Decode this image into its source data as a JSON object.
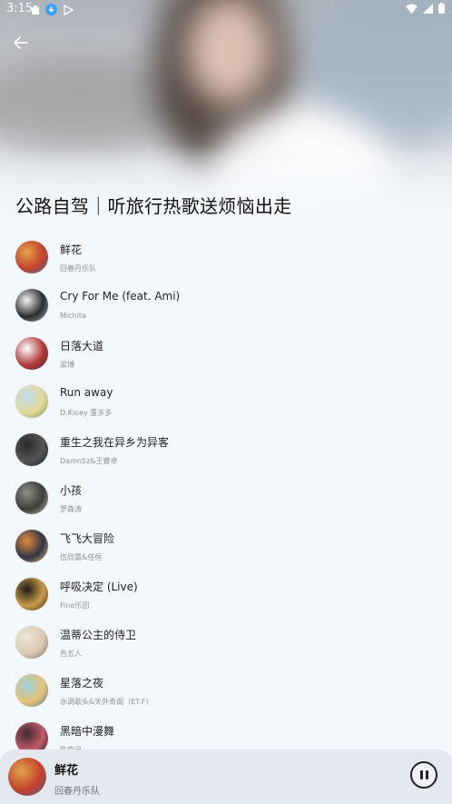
{
  "status_bar": {
    "time": "3:15"
  },
  "playlist": {
    "title": "公路自驾｜听旅行热歌送烦恼出走"
  },
  "songs": [
    {
      "title": "鲜花",
      "artist": "回春丹乐队",
      "cover_colors": [
        "#e2a44a",
        "#c3412e",
        "#4a6a8a"
      ]
    },
    {
      "title": "Cry For Me (feat. Ami)",
      "artist": "Michita",
      "cover_colors": [
        "#f2f2f2",
        "#2b2b2b",
        "#9bb5c8"
      ]
    },
    {
      "title": "日落大道",
      "artist": "梁博",
      "cover_colors": [
        "#ffffff",
        "#b23a3a",
        "#3a2a2a"
      ]
    },
    {
      "title": "Run away",
      "artist": "D.Kloey 董多多",
      "cover_colors": [
        "#bfe0ee",
        "#e6d79a",
        "#6a9a6a"
      ]
    },
    {
      "title": "重生之我在异乡为异客",
      "artist": "Damn5z&王睿卓",
      "cover_colors": [
        "#2a2a2a",
        "#555555",
        "#1a1a1a"
      ]
    },
    {
      "title": "小孩",
      "artist": "罗森涛",
      "cover_colors": [
        "#8a8f88",
        "#3d3d3a",
        "#c9c2b6"
      ]
    },
    {
      "title": "飞飞大冒险",
      "artist": "伍欣蕾&任恒",
      "cover_colors": [
        "#e58a3c",
        "#2f3548",
        "#f0c070"
      ]
    },
    {
      "title": "呼吸决定 (Live)",
      "artist": "Fine乐团",
      "cover_colors": [
        "#1d1a16",
        "#c79a4a",
        "#3a2c1a"
      ]
    },
    {
      "title": "温蒂公主的侍卫",
      "artist": "告五人",
      "cover_colors": [
        "#ece6db",
        "#d9cbb4",
        "#7b6a55"
      ]
    },
    {
      "title": "星落之夜",
      "artist": "水调歌头&天外奇阁（ET.F）",
      "cover_colors": [
        "#9ad0d8",
        "#e9c27a",
        "#4a7aa0"
      ]
    },
    {
      "title": "黑暗中漫舞",
      "artist": "陈奕迅",
      "cover_colors": [
        "#3a2a2a",
        "#c25a6a",
        "#1a1a1a"
      ]
    }
  ],
  "now_playing": {
    "title": "鲜花",
    "artist": "回春丹乐队"
  },
  "colors": {
    "background": "#f3f8fd",
    "player_bg": "#e3e8ee"
  }
}
